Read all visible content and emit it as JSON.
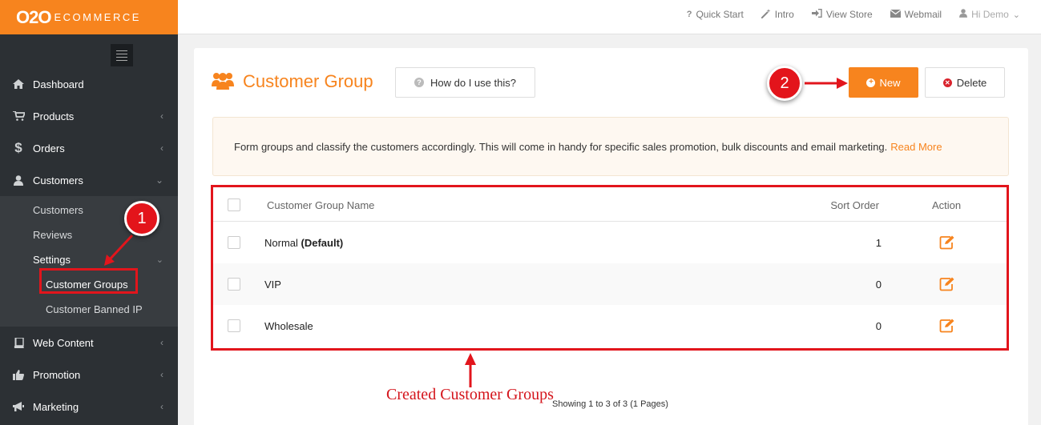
{
  "logo": {
    "main": "O2O",
    "sub": "ECOMMERCE"
  },
  "sidebar": {
    "items": [
      {
        "label": "Dashboard",
        "icon": "home-icon"
      },
      {
        "label": "Products",
        "icon": "cart-icon"
      },
      {
        "label": "Orders",
        "icon": "dollar-icon"
      },
      {
        "label": "Customers",
        "icon": "user-icon"
      }
    ],
    "customers_sub": [
      "Customers",
      "Reviews",
      "Settings"
    ],
    "settings_sub": [
      "Customer Groups",
      "Customer Banned IP"
    ],
    "lower_items": [
      {
        "label": "Web Content",
        "icon": "book-icon"
      },
      {
        "label": "Promotion",
        "icon": "thumbs-up-icon"
      },
      {
        "label": "Marketing",
        "icon": "megaphone-icon"
      }
    ]
  },
  "topbar": {
    "links": [
      {
        "label": "Quick Start",
        "icon": "question-icon"
      },
      {
        "label": "Intro",
        "icon": "magic-wand-icon"
      },
      {
        "label": "View Store",
        "icon": "sign-in-icon"
      },
      {
        "label": "Webmail",
        "icon": "envelope-icon"
      }
    ],
    "user": "Hi Demo"
  },
  "page": {
    "title": "Customer Group",
    "howto": "How do I use this?",
    "new_label": "New",
    "delete_label": "Delete",
    "info": "Form groups and classify the customers accordingly. This will come in handy for specific sales promotion, bulk discounts and email marketing.",
    "read_more": "Read More"
  },
  "table": {
    "headers": {
      "name": "Customer Group Name",
      "sort": "Sort Order",
      "action": "Action"
    },
    "rows": [
      {
        "name": "Normal",
        "suffix": "(Default)",
        "sort": "1"
      },
      {
        "name": "VIP",
        "suffix": "",
        "sort": "0"
      },
      {
        "name": "Wholesale",
        "suffix": "",
        "sort": "0"
      }
    ],
    "showing": "Showing 1 to 3 of 3 (1 Pages)"
  },
  "annotations": {
    "badge1": "1",
    "badge2": "2",
    "caption": "Created Customer Groups"
  },
  "colors": {
    "accent": "#f7841e",
    "sidebar": "#2c3034",
    "annotation": "#e2151c"
  }
}
